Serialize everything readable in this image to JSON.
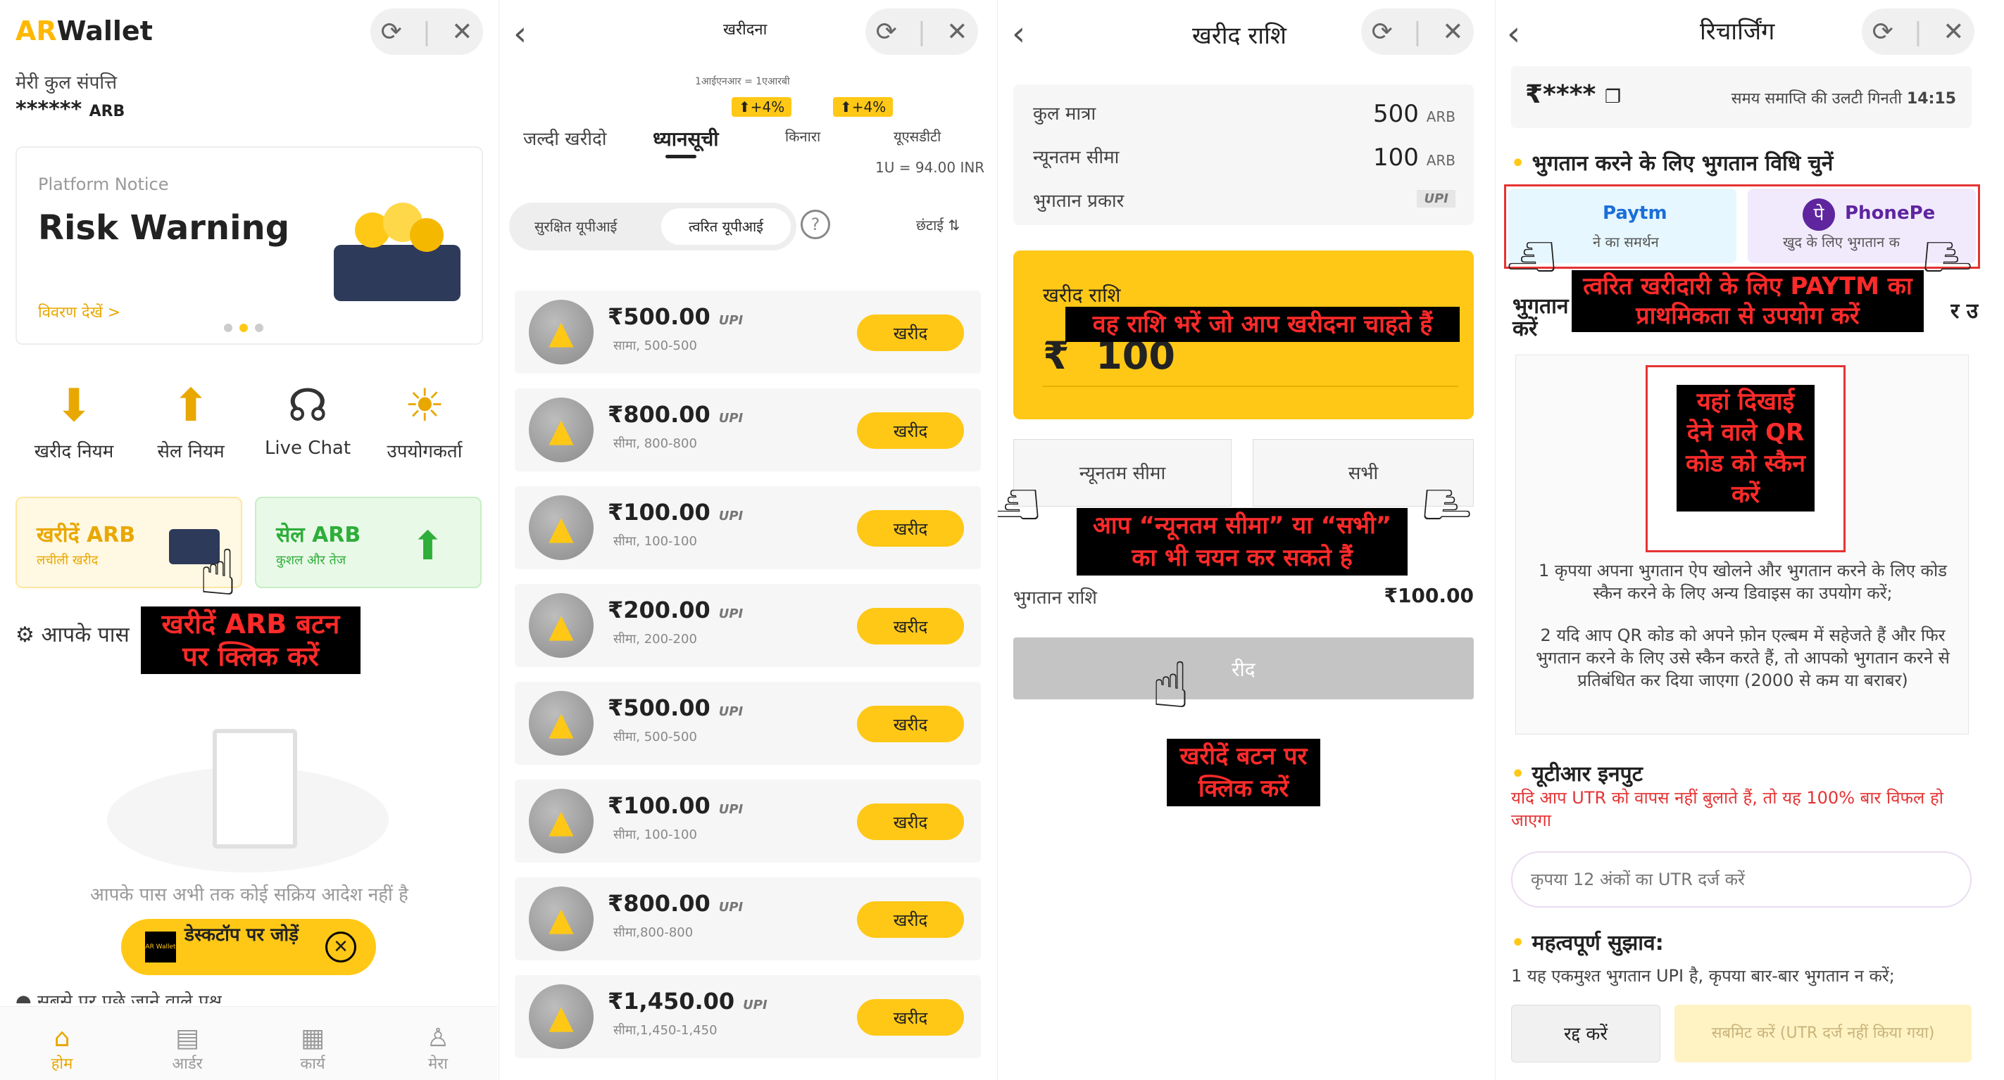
{
  "panel1": {
    "logo_ar": "AR",
    "logo_wallet": "Wallet",
    "net_worth_label": "मेरी कुल संपत्ति",
    "net_worth_value": "******",
    "net_worth_unit": "ARB",
    "notice_label": "Platform Notice",
    "notice_title": "Risk Warning",
    "notice_link": "विवरण देखें >",
    "icons": [
      {
        "label": "खरीद नियम",
        "icon": "download-book-icon"
      },
      {
        "label": "सेल नियम",
        "icon": "upload-book-icon"
      },
      {
        "label": "Live Chat",
        "icon": "headset-icon"
      },
      {
        "label": "उपयोगकर्ता",
        "icon": "user-document-icon"
      }
    ],
    "buy_title": "खरीदें ARB",
    "buy_sub": "लचीली खरीद",
    "sell_title": "सेल ARB",
    "sell_sub": "कुशल और तेज",
    "orders_prefix": "आपके पास",
    "annotation": "खरीदें ARB बटन पर क्लिक करें",
    "empty_text": "आपके पास अभी तक कोई सक्रिय आदेश नहीं है",
    "desktop_label": "डेस्कटॉप पर जोड़ें",
    "desktop_logo": "AR Wallet",
    "bottom_partial": "सबसे पर पूछे जाने वाले प्रश्न",
    "nav": [
      "होम",
      "आर्डर",
      "कार्य",
      "मेरा"
    ]
  },
  "panel2": {
    "title": "खरीदना",
    "rate_note": "1आईएनआर = 1एआरबी",
    "tabs": [
      "जल्दी खरीदो",
      "ध्यानसूची",
      "किनारा",
      "यूएसडीटी"
    ],
    "badge1": "+4%",
    "badge2": "+4%",
    "usd_rate": "1U = 94.00 INR",
    "toggle_a": "सुरक्षित यूपीआई",
    "toggle_b": "त्वरित यूपीआई",
    "sort_label": "छंटाई",
    "upi": "UPI",
    "buy_label": "खरीद",
    "items": [
      {
        "price": "₹500.00",
        "limit": "सामा, 500-500"
      },
      {
        "price": "₹800.00",
        "limit": "सीमा, 800-800"
      },
      {
        "price": "₹100.00",
        "limit": "सीमा, 100-100"
      },
      {
        "price": "₹200.00",
        "limit": "सीमा, 200-200"
      },
      {
        "price": "₹500.00",
        "limit": "सीमा, 500-500"
      },
      {
        "price": "₹100.00",
        "limit": "सीमा, 100-100"
      },
      {
        "price": "₹800.00",
        "limit": "सीमा,800-800"
      },
      {
        "price": "₹1,450.00",
        "limit": "सीमा,1,450-1,450"
      }
    ]
  },
  "panel3": {
    "title": "खरीद राशि",
    "total_label": "कुल मात्रा",
    "total_value": "500",
    "total_unit": "ARB",
    "min_label": "न्यूनतम सीमा",
    "min_value": "100",
    "min_unit": "ARB",
    "pay_type_label": "भुगतान प्रकार",
    "pay_type_value": "UPI",
    "amount_label": "खरीद राशि",
    "amount_annotation": "वह राशि भरें जो आप खरीदना चाहते हैं",
    "amount_symbol": "₹",
    "amount_value": "100",
    "min_button": "न्यूनतम सीमा",
    "all_button": "सभी",
    "choice_annotation": "आप “न्यूनतम सीमा” या “सभी” का भी चयन कर सकते हैं",
    "pay_amount_label": "भुगतान राशि",
    "pay_amount_value": "₹100.00",
    "buy_button": "रीद",
    "buy_annotation": "खरीदें बटन पर क्लिक करें"
  },
  "panel4": {
    "title": "रिचार्जिंग",
    "amount_masked": "₹****",
    "countdown_label": "समय समाप्ति की उलटी गिनती",
    "countdown_value": "14:15",
    "choose_method": "भुगतान करने के लिए भुगतान विधि चुनें",
    "paytm_logo": "Paytm",
    "paytm_sub": "ने का समर्थन",
    "phonepe_logo": "PhonePe",
    "phonepe_sub": "खुद के लिए भुगतान क",
    "method_annotation": "त्वरित खरीदारी के लिए PAYTM का प्राथमिकता से उपयोग करें",
    "hidden_left": "भुगतान",
    "hidden_left2": "करें",
    "hidden_right": "र उप",
    "qr_annotation": "यहां दिखाई देने वाले QR कोड को स्कैन करें",
    "note1": "1 कृपया अपना भुगतान ऐप खोलने और भुगतान करने के लिए कोड स्कैन करने के लिए अन्य डिवाइस का उपयोग करें;",
    "note2": "2 यदि आप QR कोड को अपने फ़ोन एल्बम में सहेजते हैं और फिर भुगतान करने के लिए उसे स्कैन करते हैं, तो आपको भुगतान करने से प्रतिबंधित कर दिया जाएगा (2000 से कम या बराबर)",
    "utr_title": "यूटीआर इनपुट",
    "utr_warning": "यदि आप UTR को वापस नहीं बुलाते हैं, तो यह 100% बार विफल हो जाएगा",
    "utr_placeholder": "कृपया 12 अंकों का UTR दर्ज करें",
    "tips_title": "महत्वपूर्ण सुझाव:",
    "tips_text": "1 यह एकमुश्त भुगतान UPI है, कृपया बार-बार भुगतान न करें;",
    "cancel_button": "रद्द करें",
    "submit_button": "सबमिट करें (UTR दर्ज नहीं किया गया)"
  },
  "colors": {
    "accent": "#ffc816",
    "annotation_red": "#ff2a2a",
    "green": "#e9f9e8"
  }
}
